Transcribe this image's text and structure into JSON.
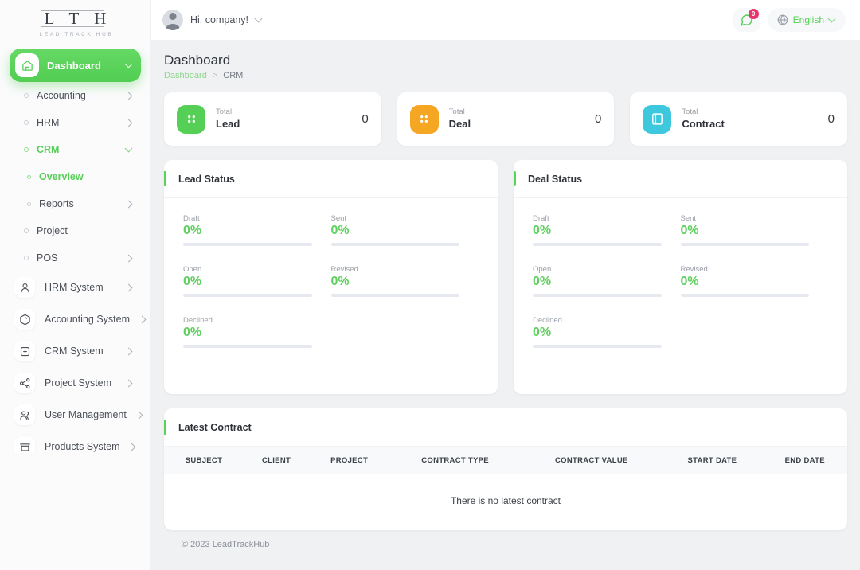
{
  "brand": {
    "mark": "L T H",
    "sub": "LEAD TRACK HUB"
  },
  "sidebar": {
    "items": [
      {
        "label": "Dashboard",
        "icon": "home-icon",
        "state": "active",
        "chevron": "down"
      },
      {
        "label": "Accounting",
        "icon": "bullet",
        "state": "normal",
        "chevron": "right"
      },
      {
        "label": "HRM",
        "icon": "bullet",
        "state": "normal",
        "chevron": "right"
      },
      {
        "label": "CRM",
        "icon": "bullet",
        "state": "green",
        "chevron": "down"
      },
      {
        "label": "Overview",
        "icon": "bullet",
        "state": "green-sub",
        "chevron": "none"
      },
      {
        "label": "Reports",
        "icon": "bullet",
        "state": "sub",
        "chevron": "right"
      },
      {
        "label": "Project",
        "icon": "bullet",
        "state": "normal",
        "chevron": "none"
      },
      {
        "label": "POS",
        "icon": "bullet",
        "state": "normal",
        "chevron": "right"
      },
      {
        "label": "HRM System",
        "icon": "user-icon",
        "state": "system",
        "chevron": "right"
      },
      {
        "label": "Accounting System",
        "icon": "box-icon",
        "state": "system",
        "chevron": "right"
      },
      {
        "label": "CRM System",
        "icon": "crm-icon",
        "state": "system",
        "chevron": "right"
      },
      {
        "label": "Project System",
        "icon": "share-icon",
        "state": "system",
        "chevron": "right"
      },
      {
        "label": "User Management",
        "icon": "users-icon",
        "state": "system",
        "chevron": "right"
      },
      {
        "label": "Products System",
        "icon": "products-icon",
        "state": "system",
        "chevron": "right"
      }
    ]
  },
  "topbar": {
    "greeting": "Hi, company!",
    "notification_count": "0",
    "language": "English",
    "icons": {
      "avatar": "avatar",
      "chat": "chat-icon",
      "globe": "globe-icon",
      "chevron": "chevron-down-icon"
    }
  },
  "header": {
    "title": "Dashboard",
    "breadcrumb": {
      "parent": "Dashboard",
      "separator": ">",
      "current": "CRM"
    }
  },
  "stat_cards": [
    {
      "sub": "Total",
      "name": "Lead",
      "value": "0",
      "icon": "grid-icon",
      "color": "#55cf55"
    },
    {
      "sub": "Total",
      "name": "Deal",
      "value": "0",
      "icon": "grid-icon",
      "color": "#f5a623"
    },
    {
      "sub": "Total",
      "name": "Contract",
      "value": "0",
      "icon": "document-icon",
      "color": "#3ec8dd"
    }
  ],
  "lead_status": {
    "title": "Lead Status",
    "stats": [
      {
        "label": "Draft",
        "value": "0%"
      },
      {
        "label": "Sent",
        "value": "0%"
      },
      {
        "label": "Open",
        "value": "0%"
      },
      {
        "label": "Revised",
        "value": "0%"
      },
      {
        "label": "Declined",
        "value": "0%"
      }
    ]
  },
  "deal_status": {
    "title": "Deal Status",
    "stats": [
      {
        "label": "Draft",
        "value": "0%"
      },
      {
        "label": "Sent",
        "value": "0%"
      },
      {
        "label": "Open",
        "value": "0%"
      },
      {
        "label": "Revised",
        "value": "0%"
      },
      {
        "label": "Declined",
        "value": "0%"
      }
    ]
  },
  "latest_contract": {
    "title": "Latest Contract",
    "columns": [
      "SUBJECT",
      "CLIENT",
      "PROJECT",
      "CONTRACT TYPE",
      "CONTRACT VALUE",
      "START DATE",
      "END DATE"
    ],
    "empty_message": "There is no latest contract"
  },
  "footer": {
    "copyright": "© 2023 LeadTrackHub"
  },
  "colors": {
    "accent": "#55cf55",
    "badge": "#e8356d",
    "deal": "#f5a623",
    "contract": "#3ec8dd"
  }
}
